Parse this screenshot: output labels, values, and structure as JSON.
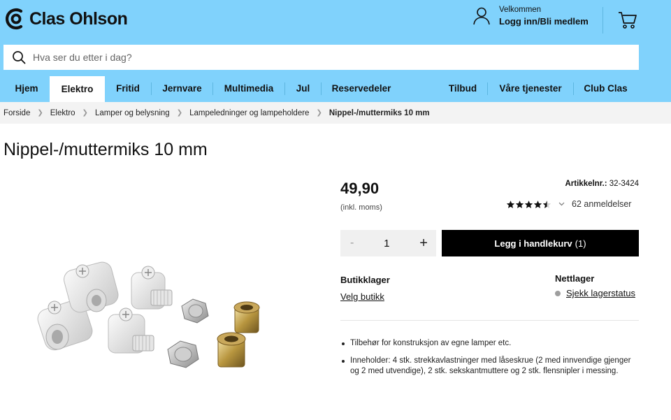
{
  "header": {
    "brand": "Clas Ohlson",
    "welcome": "Velkommen",
    "login": "Logg inn/Bli medlem",
    "search_placeholder": "Hva ser du etter i dag?"
  },
  "nav": {
    "items": [
      {
        "label": "Hjem"
      },
      {
        "label": "Elektro",
        "active": true
      },
      {
        "label": "Fritid"
      },
      {
        "label": "Jernvare"
      },
      {
        "label": "Multimedia"
      },
      {
        "label": "Jul"
      },
      {
        "label": "Reservedeler"
      },
      {
        "label": "Tilbud"
      },
      {
        "label": "Våre tjenester"
      },
      {
        "label": "Club Clas"
      }
    ]
  },
  "breadcrumb": [
    "Forside",
    "Elektro",
    "Lamper og belysning",
    "Lampeledninger og lampeholdere",
    "Nippel-/muttermiks 10 mm"
  ],
  "product": {
    "title": "Nippel-/muttermiks 10 mm",
    "price": "49,90",
    "price_note": "(inkl. moms)",
    "article_label": "Artikkelnr.:",
    "article_number": "32-3424",
    "rating": 4.5,
    "reviews": "62 anmeldelser",
    "quantity": "1",
    "qty_minus": "-",
    "qty_plus": "+",
    "add_to_cart": "Legg i handlekurv",
    "cart_count": "(1)",
    "store_stock_heading": "Butikklager",
    "store_select": "Velg butikk",
    "online_stock_heading": "Nettlager",
    "online_stock_link": "Sjekk lagerstatus",
    "bullets": [
      "Tilbehør for konstruksjon av egne lamper etc.",
      "Inneholder: 4 stk. strekkavlastninger med låseskrue (2 med innvendige gjenger og 2 med utvendige), 2 stk. sekskantmuttere og 2 stk. flensnipler i messing."
    ]
  },
  "colors": {
    "header_bg": "#80d2fc",
    "button_bg": "#000000",
    "breadcrumb_bg": "#f3f3f3"
  }
}
